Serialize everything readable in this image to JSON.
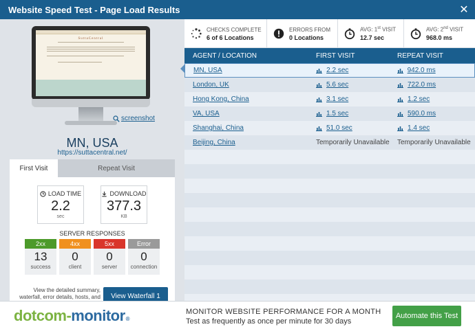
{
  "window": {
    "title": "Website Speed Test - Page Load Results",
    "close_icon": "close-icon"
  },
  "screenshot_preview": {
    "site_brand": "SuttaCentral",
    "link_label": "screenshot"
  },
  "location": {
    "name": "MN, USA",
    "url": "https://suttacentral.net/"
  },
  "tabs": [
    {
      "label": "First Visit",
      "active": true
    },
    {
      "label": "Repeat Visit",
      "active": false
    }
  ],
  "metrics": {
    "load_time": {
      "label": "LOAD TIME",
      "value": "2.2",
      "unit": "sec",
      "icon": "clock-icon"
    },
    "download": {
      "label": "DOWNLOAD",
      "value": "377.3",
      "unit": "KB",
      "icon": "download-icon"
    }
  },
  "server_responses": {
    "title": "SERVER RESPONSES",
    "items": [
      {
        "code": "2xx",
        "count": "13",
        "desc": "success",
        "color": "#4c9a2a"
      },
      {
        "code": "4xx",
        "count": "0",
        "desc": "client",
        "color": "#f0901e"
      },
      {
        "code": "5xx",
        "count": "0",
        "desc": "server",
        "color": "#d9362b"
      },
      {
        "code": "Error",
        "count": "0",
        "desc": "connection",
        "color": "#9a9a9a"
      }
    ]
  },
  "details_text": "View the detailed summary, waterfall, error details, hosts, and fastest/slowest elements",
  "waterfall_button": "View Waterfall 1",
  "stats": {
    "checks": {
      "label": "CHECKS COMPLETE",
      "value": "6 of 6 Locations",
      "icon": "spinner-icon"
    },
    "errors": {
      "label": "ERRORS FROM",
      "value": "0 Locations",
      "icon": "alert-icon"
    },
    "avg_first": {
      "label_prefix": "AVG: 1",
      "label_sup": "st",
      "label_suffix": " VISIT",
      "value": "12.7 sec",
      "icon": "stopwatch-icon"
    },
    "avg_second": {
      "label_prefix": "AVG: 2",
      "label_sup": "nd",
      "label_suffix": " VISIT",
      "value": "968.0 ms",
      "icon": "stopwatch-icon"
    }
  },
  "table": {
    "headers": {
      "location": "AGENT / LOCATION",
      "first": "FIRST VISIT",
      "repeat": "REPEAT VISIT"
    },
    "rows": [
      {
        "location": "MN, USA",
        "first": "2.2 sec",
        "repeat": "942.0 ms",
        "available": true
      },
      {
        "location": "London, UK",
        "first": "5.6 sec",
        "repeat": "722.0 ms",
        "available": true
      },
      {
        "location": "Hong Kong, China",
        "first": "3.1 sec",
        "repeat": "1.2 sec",
        "available": true
      },
      {
        "location": "VA, USA",
        "first": "1.5 sec",
        "repeat": "590.0 ms",
        "available": true
      },
      {
        "location": "Shanghai, China",
        "first": "51.0 sec",
        "repeat": "1.4 sec",
        "available": true
      },
      {
        "location": "Beijing, China",
        "first": "Temporarily Unavailable",
        "repeat": "Temporarily Unavailable",
        "available": false
      }
    ]
  },
  "banner": {
    "logo_part1": "dotcom-",
    "logo_part2": "monitor",
    "logo_reg": "®",
    "promo_line1": "MONITOR WEBSITE PERFORMANCE FOR A MONTH",
    "promo_line2": "Test as frequently as once per minute for 30 days",
    "cta": "Automate this Test"
  },
  "colors": {
    "primary": "#1a5e8e",
    "cta_green": "#43a047",
    "logo_green": "#7cb342",
    "logo_blue": "#2c6aa0"
  }
}
